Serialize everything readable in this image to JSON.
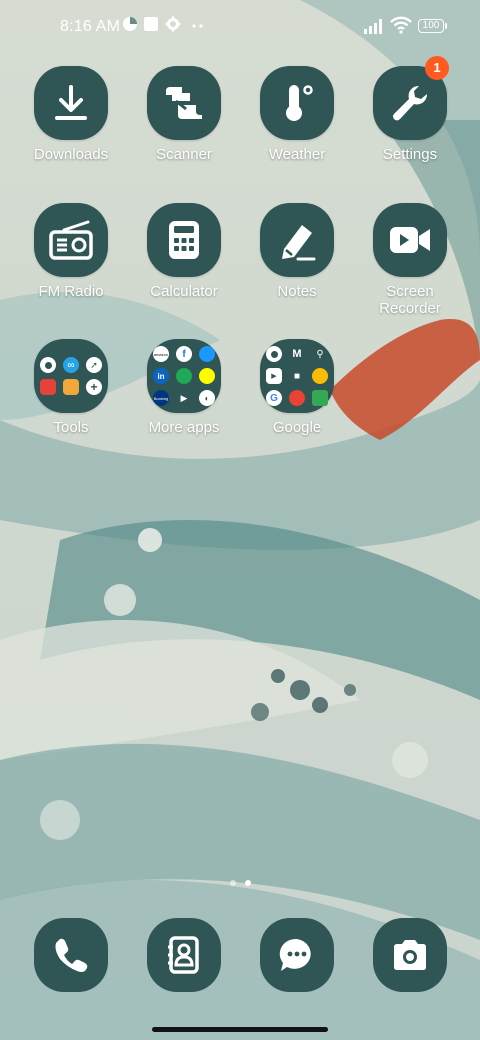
{
  "status_bar": {
    "time": "8:16 AM",
    "battery": "100"
  },
  "apps": [
    {
      "label": "Downloads",
      "icon": "download-icon"
    },
    {
      "label": "Scanner",
      "icon": "scanner-icon"
    },
    {
      "label": "Weather",
      "icon": "thermometer-icon"
    },
    {
      "label": "Settings",
      "icon": "wrench-icon",
      "badge": "1"
    },
    {
      "label": "FM Radio",
      "icon": "radio-icon"
    },
    {
      "label": "Calculator",
      "icon": "calculator-icon"
    },
    {
      "label": "Notes",
      "icon": "pencil-icon"
    },
    {
      "label": "Screen Recorder",
      "icon": "video-camera-icon"
    }
  ],
  "folders": [
    {
      "label": "Tools"
    },
    {
      "label": "More apps",
      "apps_text": {
        "amazon": "amazon",
        "linkedin": "in",
        "booking": "Booking"
      }
    },
    {
      "label": "Google"
    }
  ],
  "dock": [
    {
      "icon": "phone-icon"
    },
    {
      "icon": "contacts-icon"
    },
    {
      "icon": "messages-icon"
    },
    {
      "icon": "camera-icon"
    }
  ],
  "colors": {
    "icon_bg": "#2f5555",
    "badge": "#ff5a1f"
  }
}
